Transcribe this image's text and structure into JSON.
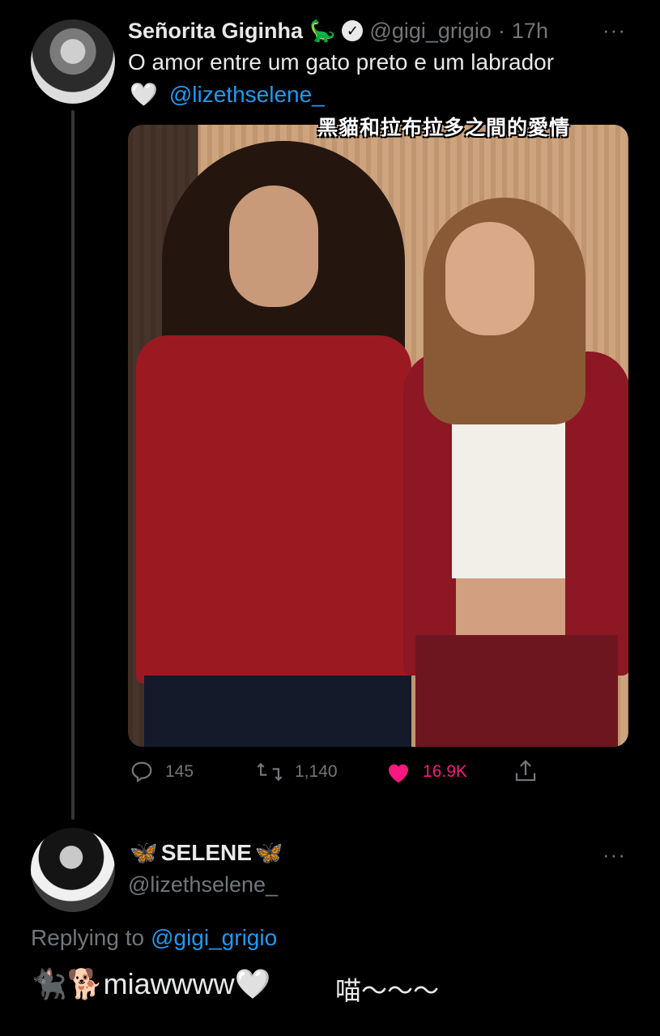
{
  "tweet": {
    "author_name": "Señorita Giginha",
    "author_emoji": "🦕",
    "verified_mark": "✓",
    "handle": "@gigi_grigio",
    "separator": "·",
    "time": "17h",
    "more": "···",
    "text_line1": "O amor entre um gato preto e um labrador",
    "text_heart": "🤍",
    "mention": "@lizethselene_",
    "image_caption_overlay": "黑貓和拉布拉多之間的愛情",
    "actions": {
      "replies": "145",
      "retweets": "1,140",
      "likes": "16.9K"
    },
    "colors": {
      "like": "#f91880",
      "link": "#1d9bf0",
      "muted": "#71767b"
    }
  },
  "reply": {
    "author_prefix_emoji": "🦋",
    "author_name": "SELENE",
    "author_suffix_emoji": "🦋",
    "handle": "@lizethselene_",
    "more": "···",
    "replying_to_label": "Replying to",
    "replying_to_handle": "@gigi_grigio",
    "text_emoji": "🐈‍⬛🐕",
    "text": "miawwww",
    "text_heart": "🤍",
    "translation": "喵～～～"
  }
}
